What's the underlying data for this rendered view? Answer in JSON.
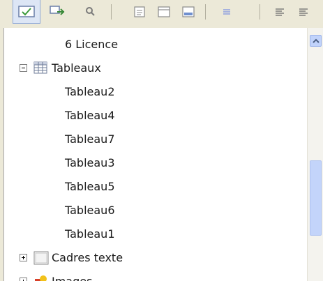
{
  "navigator": {
    "items": [
      {
        "label": "6 Licence"
      },
      {
        "label": "Tableaux",
        "expanded": true,
        "icon": "table-icon"
      },
      {
        "label": "Tableau2"
      },
      {
        "label": "Tableau4"
      },
      {
        "label": "Tableau7"
      },
      {
        "label": "Tableau3"
      },
      {
        "label": "Tableau5"
      },
      {
        "label": "Tableau6"
      },
      {
        "label": "Tableau1"
      },
      {
        "label": "Cadres texte",
        "expanded": false,
        "icon": "text-frame-icon"
      },
      {
        "label": "Images",
        "expanded": false,
        "icon": "image-icon"
      }
    ]
  },
  "toolbar": {
    "icons": [
      "navigation-toggle-icon",
      "drag-mode-icon",
      "headings-icon",
      "list-box-icon",
      "header-icon",
      "footer-icon",
      "anchor-icon",
      "promote-level-icon",
      "demote-level-icon"
    ]
  },
  "colors": {
    "toolbar_bg": "#ece9d8",
    "scroll_thumb": "#c3d4fa",
    "text": "#1a1a1a"
  }
}
